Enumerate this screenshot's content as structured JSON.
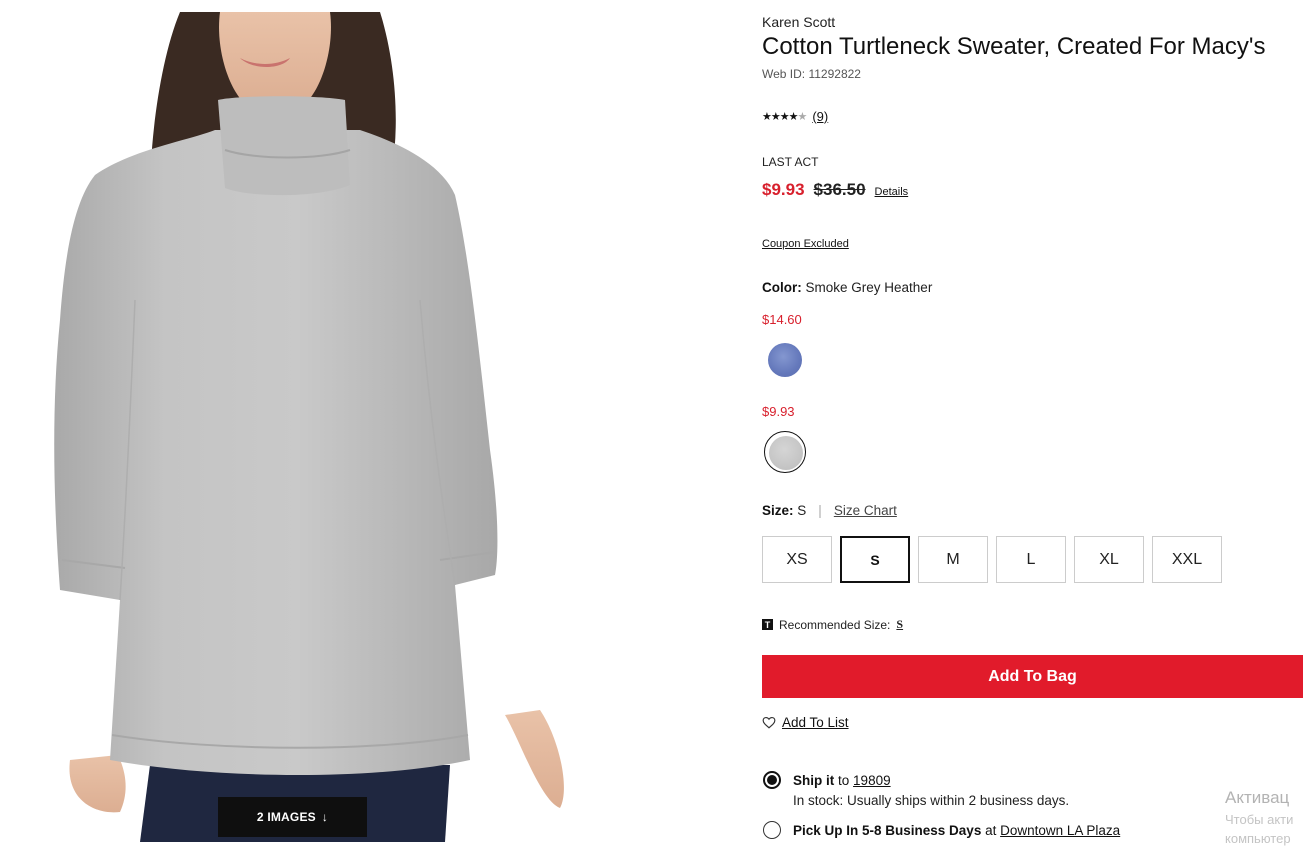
{
  "product": {
    "brand": "Karen Scott",
    "title": "Cotton Turtleneck Sweater, Created For Macy's",
    "web_id": "Web ID: 11292822",
    "rating": {
      "stars": 4,
      "max": 5,
      "count": "(9)"
    },
    "badge": "LAST ACT",
    "price_sale": "$9.93",
    "price_original": "$36.50",
    "details_link": "Details",
    "coupon_link": "Coupon Excluded"
  },
  "color": {
    "label": "Color:",
    "selected": "Smoke Grey Heather",
    "swatches": [
      {
        "price": "$14.60",
        "color": "#6b7fc1",
        "selected": false
      },
      {
        "price": "$9.93",
        "color": "#c8c8c8",
        "selected": true
      }
    ]
  },
  "size": {
    "label": "Size:",
    "selected": "S",
    "chart_link": "Size Chart",
    "options": [
      "XS",
      "S",
      "M",
      "L",
      "XL",
      "XXL"
    ],
    "recommended_label": "Recommended Size:",
    "recommended_value": "S",
    "recommended_icon": "T"
  },
  "actions": {
    "add_to_bag": "Add To Bag",
    "add_to_list": "Add To List"
  },
  "fulfillment": {
    "ship_label": "Ship it",
    "ship_to_word": "to",
    "ship_zip": "19809",
    "ship_stock": "In stock: Usually ships within 2 business days.",
    "pickup_label": "Pick Up In 5-8 Business Days",
    "pickup_at_word": "at",
    "pickup_store": "Downtown LA Plaza"
  },
  "gallery": {
    "images_button": "2 IMAGES",
    "arrow": "↓"
  },
  "watermark": {
    "line1": "Активац",
    "line2": "Чтобы акти",
    "line3": "компьютер"
  },
  "colors": {
    "accent_red": "#e11b2b",
    "sale_red": "#d8202d"
  }
}
